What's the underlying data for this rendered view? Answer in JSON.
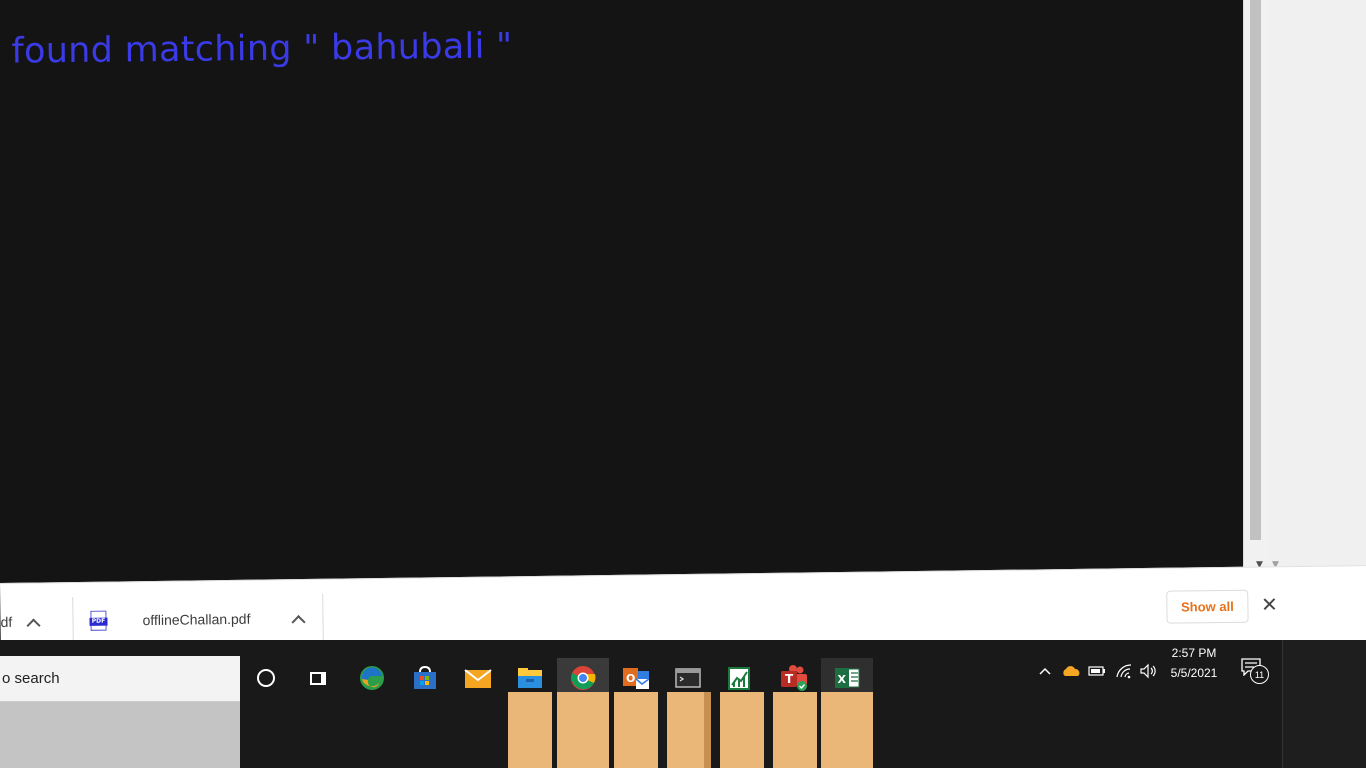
{
  "content": {
    "no_data_text": "a found matching \" bahubali \""
  },
  "download_shelf": {
    "items": [
      {
        "name": "df"
      },
      {
        "name": "offlineChallan.pdf",
        "icon": "pdf-file-icon",
        "icon_text": "PDF"
      }
    ],
    "show_all_label": "Show all",
    "close_glyph": "✕"
  },
  "taskbar": {
    "search_placeholder": "o search",
    "pinned_apps": [
      "cortana",
      "task-view",
      "edge",
      "microsoft-store",
      "mail",
      "file-explorer",
      "chrome",
      "outlook",
      "terminal",
      "stock-chart-app",
      "teams",
      "excel"
    ],
    "clock": {
      "time": "2:57 PM",
      "date": "5/5/2021"
    },
    "notification_count": "11",
    "tray": [
      "chevron-up-icon",
      "onedrive-icon",
      "battery-icon",
      "wifi-icon",
      "volume-icon"
    ]
  },
  "colors": {
    "page_bg": "#141414",
    "no_data_text": "#3a3ae6",
    "show_all": "#e8721c",
    "thumbnail": "#ebb779"
  }
}
